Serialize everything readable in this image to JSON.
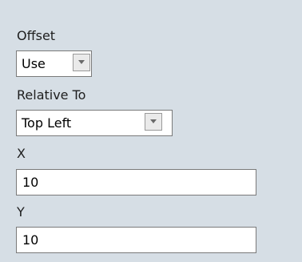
{
  "offset": {
    "label": "Offset",
    "selected": "Use"
  },
  "relative_to": {
    "label": "Relative To",
    "selected": "Top Left"
  },
  "x_field": {
    "label": "X",
    "value": "10"
  },
  "y_field": {
    "label": "Y",
    "value": "10"
  },
  "icons": {
    "dropdown": "chevron-down-icon"
  },
  "colors": {
    "panel_background": "#d6dee5",
    "field_background": "#ffffff",
    "field_border": "#7a7a7a"
  }
}
